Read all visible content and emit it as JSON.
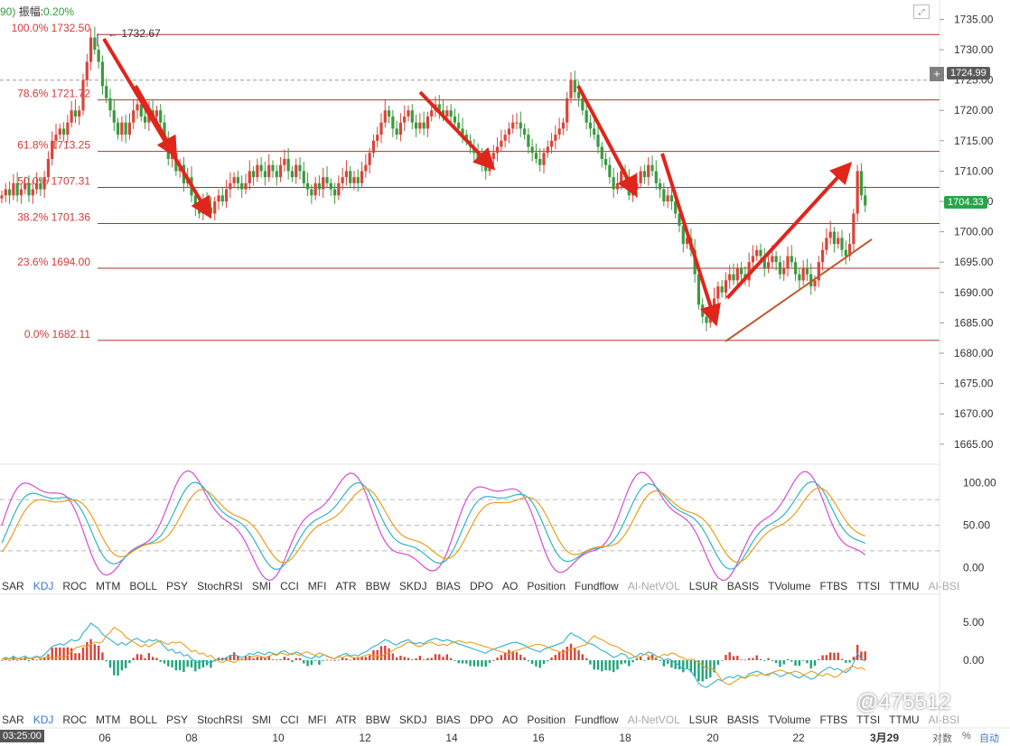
{
  "header": {
    "prefix": "90)",
    "amplitude_label": "振幅:",
    "amplitude_value": "0.20%"
  },
  "price_badges": {
    "dashed_level": "1724.99",
    "current": "1704.33",
    "peak_note": "1732.67",
    "plus": "+"
  },
  "indicator_tabs": [
    "SAR",
    "KDJ",
    "ROC",
    "MTM",
    "BOLL",
    "PSY",
    "StochRSI",
    "SMI",
    "CCI",
    "MFI",
    "ATR",
    "BBW",
    "SKDJ",
    "BIAS",
    "DPO",
    "AO",
    "Position",
    "Fundflow",
    "AI-NetVOL",
    "LSUR",
    "BASIS",
    "TVolume",
    "FTBS",
    "TTSI",
    "TTMU",
    "AI-BSI"
  ],
  "active_tab": "KDJ",
  "disabled_tabs": [
    "AI-NetVOL",
    "AI-BSI"
  ],
  "footer": {
    "time": "03:25:00",
    "log_label": "对数",
    "percent_label": "%",
    "auto_label": "自动",
    "watermark": "@475512"
  },
  "colors": {
    "up": "#d9443a",
    "down": "#3a9a3e",
    "fib_line": "#b03030",
    "fib_text": "#d33a3a",
    "arrow": "#e0251b",
    "trendline": "#c05a30",
    "k_line": "#d84bd0",
    "d_line": "#2fb4c8",
    "j_line": "#e8a01c",
    "badge_dark": "#5b5b5b",
    "badge_green": "#2aa44a"
  },
  "chart_data": {
    "type": "candlestick",
    "x_ticks": [
      "06",
      "08",
      "10",
      "12",
      "14",
      "16",
      "18",
      "20",
      "22",
      "3月29"
    ],
    "y_ticks": [
      1735,
      1730,
      1725,
      1720,
      1715,
      1710,
      1705,
      1700,
      1695,
      1690,
      1685,
      1680,
      1675,
      1670,
      1665
    ],
    "y_tick_labels": [
      "1735.00",
      "1730.00",
      "1725.00",
      "1720.00",
      "1715.00",
      "1710.00",
      "1705.00",
      "1700.00",
      "1695.00",
      "1690.00",
      "1685.00",
      "1680.00",
      "1675.00",
      "1670.00",
      "1665.00"
    ],
    "ylim": [
      1662,
      1737
    ],
    "fib_levels": [
      {
        "label": "100.0% 1732.50",
        "value": 1732.5
      },
      {
        "label": "78.6% 1721.72",
        "value": 1721.72
      },
      {
        "label": "61.8% 1713.25",
        "value": 1713.25
      },
      {
        "label": "50.0% 1707.31",
        "value": 1707.31
      },
      {
        "label": "38.2% 1701.36",
        "value": 1701.36
      },
      {
        "label": "23.6% 1694.00",
        "value": 1694.0
      },
      {
        "label": "0.0% 1682.11",
        "value": 1682.11
      }
    ],
    "dashed_level": 1724.99,
    "close_series": [
      1706,
      1707,
      1706,
      1708,
      1706,
      1707,
      1708,
      1706,
      1707,
      1708,
      1707,
      1709,
      1712,
      1715,
      1716,
      1717,
      1716,
      1718,
      1720,
      1719,
      1720,
      1725,
      1728,
      1732,
      1730,
      1728,
      1724,
      1722,
      1720,
      1718,
      1716,
      1718,
      1716,
      1718,
      1720,
      1721,
      1719,
      1718,
      1720,
      1719,
      1720,
      1718,
      1715,
      1712,
      1713,
      1710,
      1711,
      1708,
      1709,
      1706,
      1704,
      1703,
      1705,
      1704,
      1703,
      1705,
      1706,
      1705,
      1707,
      1708,
      1709,
      1708,
      1707,
      1708,
      1710,
      1709,
      1711,
      1710,
      1709,
      1711,
      1710,
      1709,
      1711,
      1712,
      1710,
      1709,
      1711,
      1710,
      1708,
      1707,
      1706,
      1708,
      1707,
      1709,
      1708,
      1707,
      1706,
      1708,
      1709,
      1710,
      1708,
      1709,
      1708,
      1710,
      1711,
      1713,
      1715,
      1716,
      1718,
      1720,
      1719,
      1717,
      1716,
      1718,
      1719,
      1720,
      1718,
      1717,
      1718,
      1717,
      1719,
      1720,
      1721,
      1720,
      1719,
      1720,
      1719,
      1718,
      1717,
      1716,
      1715,
      1714,
      1713,
      1712,
      1711,
      1710,
      1712,
      1713,
      1714,
      1715,
      1716,
      1717,
      1718,
      1718,
      1717,
      1716,
      1714,
      1713,
      1712,
      1711,
      1713,
      1714,
      1715,
      1716,
      1717,
      1718,
      1722,
      1725,
      1723,
      1722,
      1720,
      1718,
      1717,
      1716,
      1714,
      1712,
      1711,
      1709,
      1707,
      1708,
      1710,
      1709,
      1706,
      1707,
      1708,
      1710,
      1709,
      1711,
      1710,
      1708,
      1707,
      1705,
      1706,
      1705,
      1703,
      1701,
      1698,
      1699,
      1697,
      1693,
      1688,
      1686,
      1685,
      1687,
      1689,
      1691,
      1690,
      1692,
      1693,
      1692,
      1694,
      1693,
      1692,
      1695,
      1696,
      1697,
      1696,
      1694,
      1695,
      1696,
      1695,
      1693,
      1694,
      1696,
      1695,
      1693,
      1692,
      1694,
      1693,
      1691,
      1692,
      1695,
      1697,
      1699,
      1700,
      1698,
      1699,
      1697,
      1696,
      1698,
      1703,
      1710,
      1706,
      1704.33
    ],
    "kdj_ylim": [
      -12,
      110
    ],
    "kdj_ticks": [
      100,
      50,
      0
    ],
    "kdj_tick_labels": [
      "100.00",
      "50.00",
      "0.00"
    ],
    "kdj_dashed": [
      80,
      50,
      20
    ],
    "macd_ylim": [
      -7,
      7
    ],
    "macd_ticks": [
      5,
      0
    ],
    "macd_tick_labels": [
      "5.00",
      "0.00"
    ],
    "annotations": [
      "1732.67"
    ]
  }
}
